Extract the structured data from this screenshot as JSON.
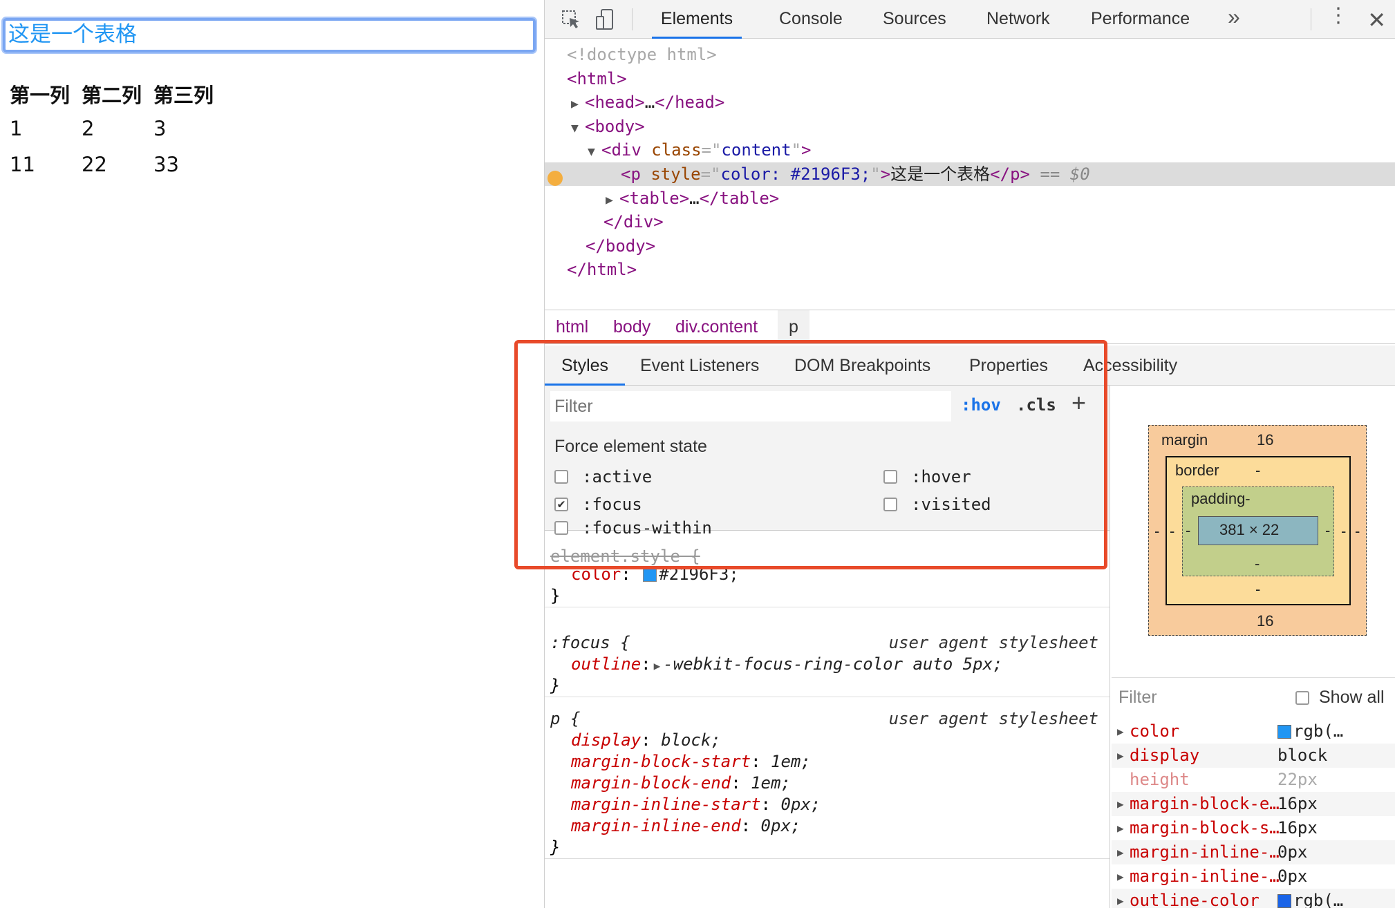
{
  "page": {
    "paragraph": "这是一个表格",
    "table": {
      "headers": [
        "第一列",
        "第二列",
        "第三列"
      ],
      "rows": [
        [
          "1",
          "2",
          "3"
        ],
        [
          "11",
          "22",
          "33"
        ]
      ]
    }
  },
  "devtools": {
    "tabs": [
      "Elements",
      "Console",
      "Sources",
      "Network",
      "Performance"
    ],
    "more_tabs": "»",
    "dom": {
      "doctype": "<!doctype html>",
      "html_open": "html",
      "head": "head",
      "head_ellipsis": "…",
      "body": "body",
      "div_tag": "div",
      "div_attr": "class",
      "div_val": "content",
      "p_tag": "p",
      "p_attr": "style",
      "p_val": "color: #2196F3;",
      "p_text": "这是一个表格",
      "p_eq": "== $0",
      "table": "table",
      "table_ellipsis": "…",
      "div_close": "div",
      "body_close": "body",
      "html_close": "html"
    },
    "breadcrumbs": [
      "html",
      "body",
      "div.content",
      "p"
    ],
    "subtabs": [
      "Styles",
      "Event Listeners",
      "DOM Breakpoints",
      "Properties",
      "Accessibility"
    ],
    "styles": {
      "filter_placeholder": "Filter",
      "hov": ":hov",
      "cls": ".cls",
      "plus": "+",
      "force_title": "Force element state",
      "states": [
        {
          "label": ":active",
          "checked": false
        },
        {
          "label": ":hover",
          "checked": false
        },
        {
          "label": ":focus",
          "checked": true
        },
        {
          "label": ":visited",
          "checked": false
        },
        {
          "label": ":focus-within",
          "checked": false
        }
      ],
      "element_style": {
        "selector": "element.style {",
        "prop": "color",
        "value": "#2196F3;",
        "swatch": "#2196F3",
        "close": "}"
      },
      "focus_rule": {
        "selector": ":focus {",
        "source": "user agent stylesheet",
        "prop": "outline",
        "value": "-webkit-focus-ring-color auto 5px;",
        "close": "}"
      },
      "p_rule": {
        "selector": "p {",
        "source": "user agent stylesheet",
        "decls": [
          {
            "prop": "display",
            "value": "block;"
          },
          {
            "prop": "margin-block-start",
            "value": "1em;"
          },
          {
            "prop": "margin-block-end",
            "value": "1em;"
          },
          {
            "prop": "margin-inline-start",
            "value": "0px;"
          },
          {
            "prop": "margin-inline-end",
            "value": "0px;"
          }
        ],
        "close": "}"
      }
    },
    "box_model": {
      "margin_label": "margin",
      "margin_top": "16",
      "margin_bottom": "16",
      "margin_side": "-",
      "border_label": "border",
      "border_top": "-",
      "border_bottom": "-",
      "border_side": "-",
      "padding_label": "padding-",
      "padding_bottom": "-",
      "padding_side": "-",
      "content": "381 × 22"
    },
    "computed": {
      "filter_placeholder": "Filter",
      "show_all": "Show all",
      "rows": [
        {
          "name": "color",
          "value": "rgb(…",
          "swatch": "#2196F3",
          "expandable": true,
          "dim": false
        },
        {
          "name": "display",
          "value": "block",
          "expandable": true,
          "dim": false
        },
        {
          "name": "height",
          "value": "22px",
          "expandable": false,
          "dim": true
        },
        {
          "name": "margin-block-e…",
          "value": "16px",
          "expandable": true,
          "dim": false
        },
        {
          "name": "margin-block-s…",
          "value": "16px",
          "expandable": true,
          "dim": false
        },
        {
          "name": "margin-inline-…",
          "value": "0px",
          "expandable": true,
          "dim": false
        },
        {
          "name": "margin-inline-…",
          "value": "0px",
          "expandable": true,
          "dim": false
        },
        {
          "name": "outline-color",
          "value": "rgb(…",
          "swatch": "#1a64e8",
          "expandable": true,
          "dim": false
        }
      ]
    }
  }
}
